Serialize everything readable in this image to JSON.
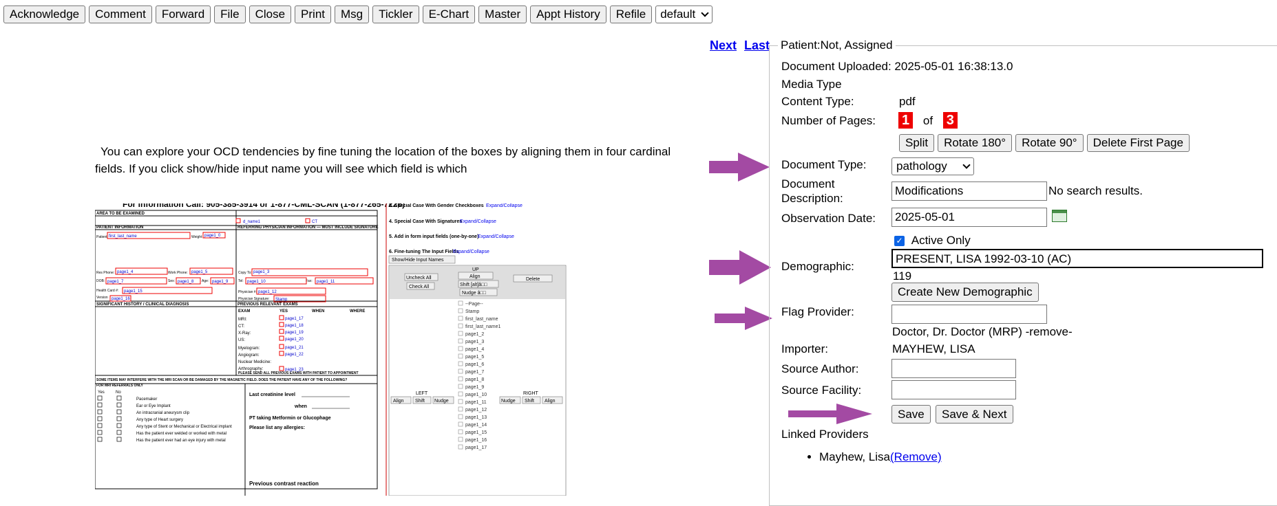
{
  "toolbar": {
    "buttons": [
      "Acknowledge",
      "Comment",
      "Forward",
      "File",
      "Close",
      "Print",
      "Msg",
      "Tickler",
      "E-Chart",
      "Master",
      "Appt History",
      "Refile"
    ],
    "select_value": "default"
  },
  "nav": {
    "next": "Next",
    "last": "Last"
  },
  "document": {
    "intro": "You can explore your OCD tendencies by fine tuning the location of the boxes by aligning them in four cardinal fields.  If you click show/hide input name you will see which field is which",
    "form": {
      "header": "For information Call: 905-385-3914 or 1-877-CML-SCAN (1-877-265-7226)",
      "area": "AREA TO BE EXAMINED",
      "patient_info": "PATIENT INFORMATION",
      "referring": "REFERRING PHYSICIAN INFORMATION — MUST INCLUDE SIGNATURE",
      "significant": "SIGNIFICANT HISTORY / CLINICAL DIAGNOSIS",
      "previous": "PREVIOUS RELEVANT EXAMS",
      "interfere": "SOME ITEMS MAY INTERFERE WITH THE MRI SCAN OR BE DAMAGED BY THE MAGNETIC FIELD. DOES THE PATIENT HAVE ANY OF THE FOLLOWING?",
      "for_mri": "FOR MRI REFERRALS ONLY",
      "yes": "Yes",
      "no": "No",
      "items": [
        "Pacemaker",
        "Ear or Eye Implant",
        "An intracranial aneurysm clip",
        "Any type of Heart surgery",
        "Any type of Stent or Mechanical or Electrical implant",
        "Has the patient ever welded or worked with metal",
        "Has the patient ever had an eye injury with metal"
      ],
      "creatinine": "Last creatinine level",
      "when": "when",
      "metformin": "PT taking Metformin or Glucophage",
      "allergies": "Please list any allergies:",
      "contrast": "Previous contrast reaction",
      "exams_header": [
        "EXAM",
        "YES",
        "WHEN",
        "WHERE"
      ],
      "exams": [
        "MRI:",
        "CT:",
        "X-Ray:",
        "US:",
        "Myelogram:",
        "Angiogram:",
        "Nuclear Medicine:",
        "Arthrography:"
      ],
      "please_send": "PLEASE SEND ALL PREVIOUS EXAMS WITH PATIENT TO APPOINTMENT",
      "left_labels": [
        "Patient",
        "Res Phone:",
        "DOB:",
        "Health Card #:",
        "Version"
      ],
      "left_labels2": [
        "Weight",
        "Work Phone:",
        "Sex:",
        "Age:"
      ],
      "right_labels": [
        "Copy To:",
        "Tel:",
        "Fax:",
        "Physician #:",
        "Physician Signature:"
      ],
      "field_tags": [
        "MRI",
        "CT",
        "first_last_name",
        "page1_0",
        "page1_4",
        "page1_5",
        "page1_7",
        "page1_8",
        "page1_9",
        "page1_10",
        "page1_11",
        "page1_12",
        "page1_13",
        "page1_15",
        "page1_16",
        "page1_17",
        "page1_18",
        "page1_19",
        "page1_20",
        "page1_21",
        "page1_22",
        "page1_23",
        "page1_3",
        "Stamp",
        "d_name1"
      ]
    },
    "tools": {
      "sections": [
        "5. Special Case With Gender Checkboxes",
        "4. Special Case With Signatures",
        "5. Add in form input fields (one-by-one)",
        "6. Fine-tuning The Input Fields"
      ],
      "expand": "Expand/Collapse",
      "show_hide": "Show/Hide Input Names",
      "uncheck_all": "Uncheck All",
      "check_all": "Check All",
      "up": "UP",
      "align": "Align",
      "shift_alt": "Shift [alt]â□□",
      "nudge_up": "Nudge â□□",
      "delete": "Delete",
      "left": "LEFT",
      "right": "RIGHT",
      "shift": "Shift",
      "nudge": "Nudge",
      "list": [
        "--Page--",
        "Stamp",
        "first_last_name",
        "first_last_name1",
        "page1_2",
        "page1_3",
        "page1_4",
        "page1_5",
        "page1_6",
        "page1_7",
        "page1_8",
        "page1_9",
        "page1_10",
        "page1_11",
        "page1_12",
        "page1_13",
        "page1_14",
        "page1_15",
        "page1_16",
        "page1_17"
      ]
    }
  },
  "panel": {
    "legend": "Patient:Not, Assigned",
    "uploaded": "Document Uploaded: 2025-05-01 16:38:13.0",
    "media_type": "Media Type",
    "content_type_label": "Content Type:",
    "content_type": "pdf",
    "pages_label": "Number of Pages:",
    "page_current": "1",
    "of": "of",
    "page_total": "3",
    "buttons": [
      "Split",
      "Rotate 180°",
      "Rotate 90°",
      "Delete First Page"
    ],
    "doc_type_label": "Document Type:",
    "doc_type": "pathology",
    "doc_desc_label1": "Document",
    "doc_desc_label2": "Description:",
    "doc_desc": "Modifications",
    "no_results": "No search results.",
    "obs_date_label": "Observation Date:",
    "obs_date": "2025-05-01",
    "active_only": "Active Only",
    "demographic_label": "Demographic:",
    "demographic": "PRESENT, LISA 1992-03-10 (AC)",
    "demographic_no": "119",
    "create_demo": "Create New Demographic",
    "flag_label": "Flag Provider:",
    "flag_value": "",
    "provider": "Doctor, Dr. Doctor (MRP) -remove-",
    "importer_label": "Importer:",
    "importer": "MAYHEW, LISA",
    "source_author_label": "Source Author:",
    "source_facility_label": "Source Facility:",
    "save": "Save",
    "save_next": "Save & Next",
    "linked_label": "Linked Providers",
    "linked_name": "Mayhew, Lisa",
    "remove": "(Remove)"
  },
  "colors": {
    "arrow": "#a34aa3",
    "link": "#0000ee",
    "page_badge": "#ee0000",
    "field_box": "#ee0000"
  }
}
